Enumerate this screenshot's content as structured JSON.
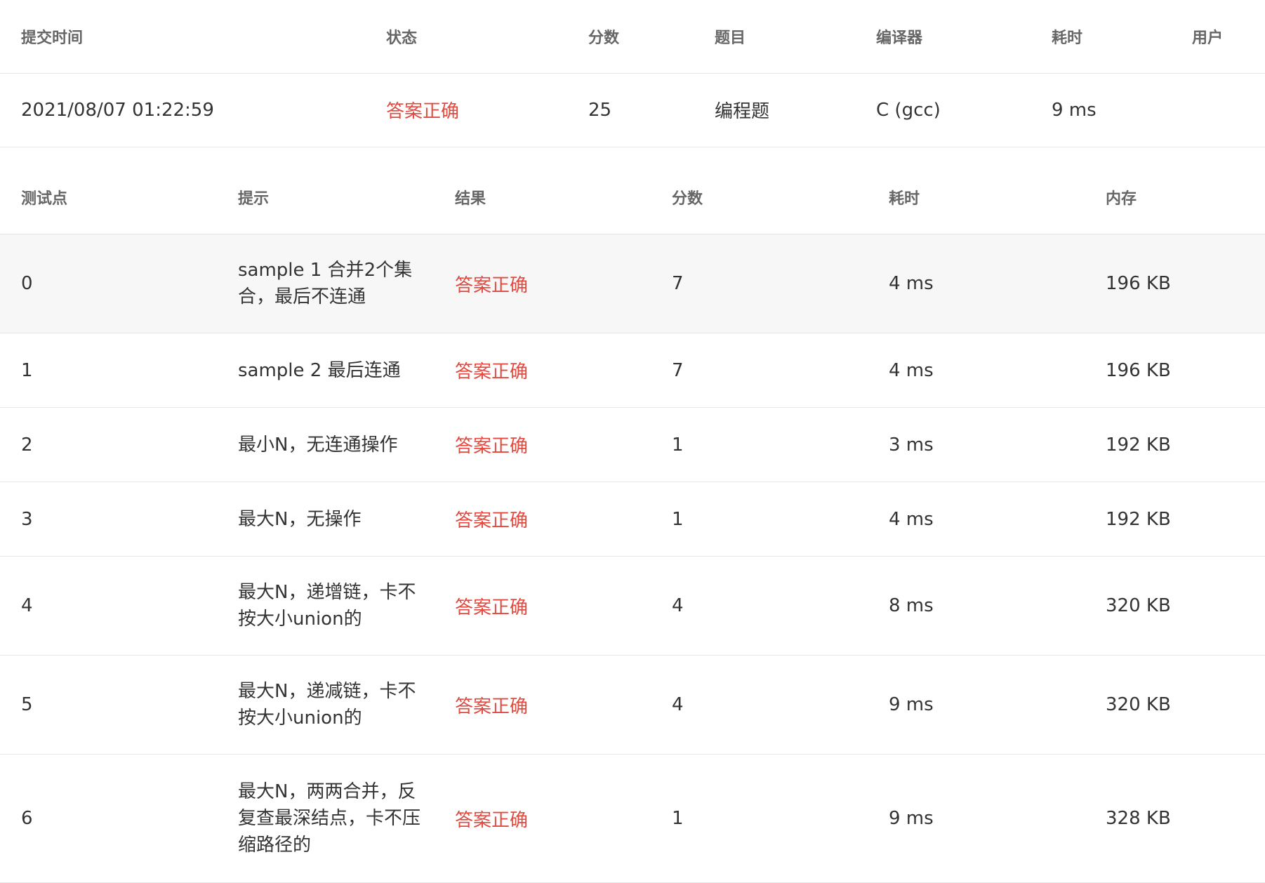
{
  "submission": {
    "headers": [
      "提交时间",
      "状态",
      "分数",
      "题目",
      "编译器",
      "耗时",
      "用户"
    ],
    "row": {
      "time": "2021/08/07 01:22:59",
      "status": "答案正确",
      "score": "25",
      "problem": "编程题",
      "compiler": "C (gcc)",
      "duration": "9 ms",
      "user": ""
    }
  },
  "cases": {
    "headers": [
      "测试点",
      "提示",
      "结果",
      "分数",
      "耗时",
      "内存"
    ],
    "rows": [
      {
        "id": "0",
        "hint": "sample 1 合并2个集合，最后不连通",
        "result": "答案正确",
        "score": "7",
        "time": "4 ms",
        "memory": "196 KB"
      },
      {
        "id": "1",
        "hint": "sample 2 最后连通",
        "result": "答案正确",
        "score": "7",
        "time": "4 ms",
        "memory": "196 KB"
      },
      {
        "id": "2",
        "hint": "最小N，无连通操作",
        "result": "答案正确",
        "score": "1",
        "time": "3 ms",
        "memory": "192 KB"
      },
      {
        "id": "3",
        "hint": "最大N，无操作",
        "result": "答案正确",
        "score": "1",
        "time": "4 ms",
        "memory": "192 KB"
      },
      {
        "id": "4",
        "hint": "最大N，递增链，卡不按大小union的",
        "result": "答案正确",
        "score": "4",
        "time": "8 ms",
        "memory": "320 KB"
      },
      {
        "id": "5",
        "hint": "最大N，递减链，卡不按大小union的",
        "result": "答案正确",
        "score": "4",
        "time": "9 ms",
        "memory": "320 KB"
      },
      {
        "id": "6",
        "hint": "最大N，两两合并，反复查最深结点，卡不压缩路径的",
        "result": "答案正确",
        "score": "1",
        "time": "9 ms",
        "memory": "328 KB"
      }
    ]
  },
  "colors": {
    "accepted": "#e2493f",
    "header_text": "#666666",
    "border": "#e6e6e6",
    "row_highlight": "#f7f7f7"
  }
}
